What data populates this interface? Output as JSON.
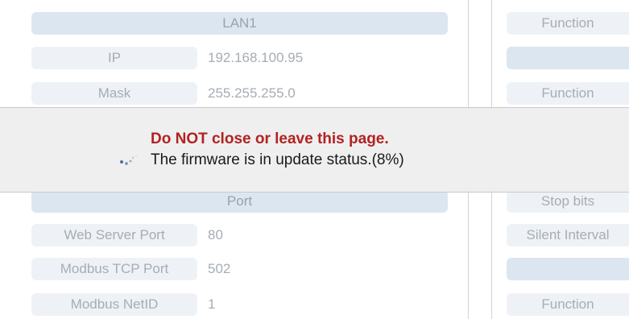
{
  "left_panel": {
    "lan_section": {
      "header": "LAN1",
      "rows": [
        {
          "label": "IP",
          "value": "192.168.100.95"
        },
        {
          "label": "Mask",
          "value": "255.255.255.0"
        }
      ]
    },
    "port_section": {
      "header": "Port",
      "rows": [
        {
          "label": "Web Server Port",
          "value": "80"
        },
        {
          "label": "Modbus TCP Port",
          "value": "502"
        },
        {
          "label": "Modbus NetID",
          "value": "1"
        }
      ]
    }
  },
  "right_panel": {
    "rows": [
      {
        "label": "Function"
      },
      {
        "label": ""
      },
      {
        "label": "Function"
      },
      {
        "label": "Stop bits"
      },
      {
        "label": "Silent Interval"
      },
      {
        "label": ""
      },
      {
        "label": "Function"
      }
    ]
  },
  "update_overlay": {
    "warning": "Do NOT close or leave this page.",
    "status": "The firmware is in update status.(8%)",
    "progress_percent": 8,
    "spinner_icon": "loading-spinner-icon",
    "warning_color": "#b22222"
  }
}
